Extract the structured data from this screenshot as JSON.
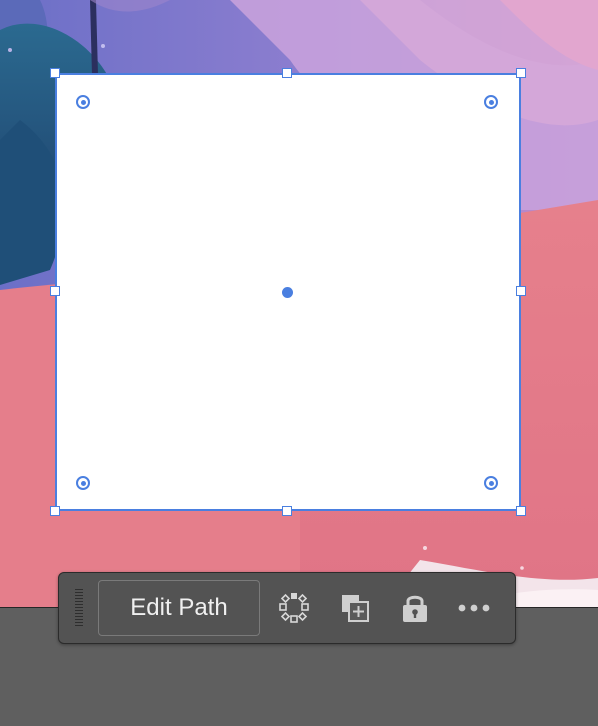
{
  "taskbar": {
    "edit_path_label": "Edit Path",
    "icons": [
      "transform-points-icon",
      "duplicate-icon",
      "lock-icon",
      "more-icon"
    ]
  },
  "colors": {
    "selection": "#4a7fe0",
    "taskbar_bg": "#535353",
    "pasteboard": "#5f5f5f"
  }
}
